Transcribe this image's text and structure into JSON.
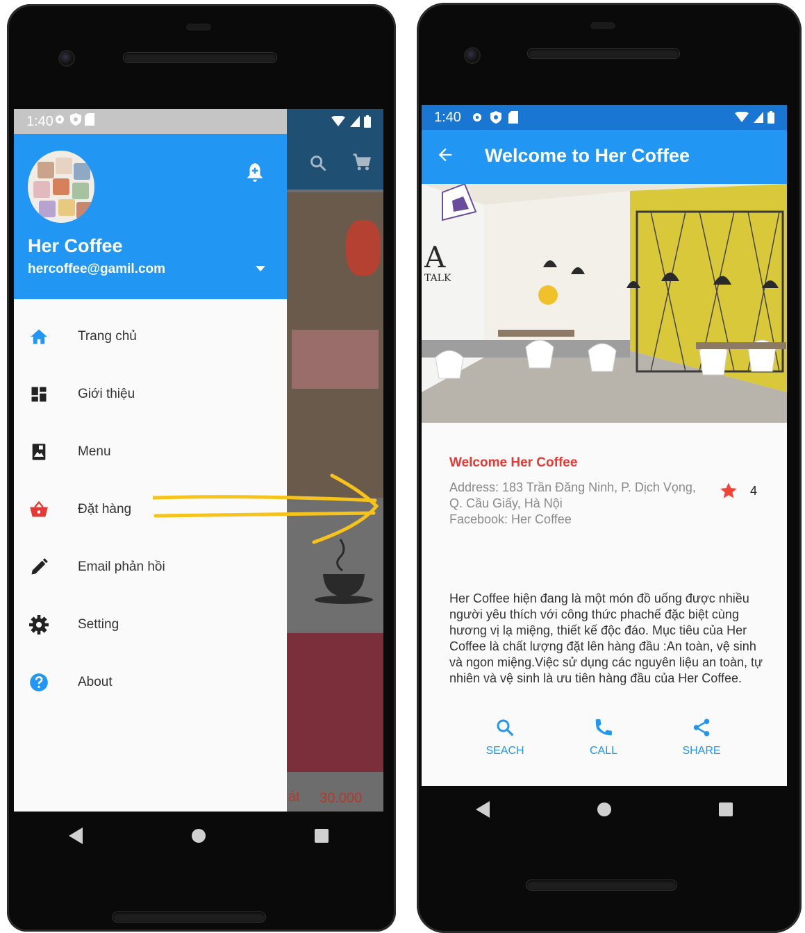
{
  "left_phone": {
    "status": {
      "time": "1:40"
    },
    "drawer": {
      "name": "Her Coffee",
      "email": "hercoffee@gamil.com",
      "items": [
        {
          "label": "Trang chủ",
          "icon": "home-icon"
        },
        {
          "label": "Giới thiệu",
          "icon": "dashboard-icon"
        },
        {
          "label": "Menu",
          "icon": "menu-book-icon"
        },
        {
          "label": "Đặt hàng",
          "icon": "basket-icon"
        },
        {
          "label": "Email phản hồi",
          "icon": "pencil-icon"
        },
        {
          "label": "Setting",
          "icon": "gear-icon"
        },
        {
          "label": "About",
          "icon": "help-icon"
        }
      ]
    },
    "background": {
      "price": "30.000",
      "price_prefix": "át"
    }
  },
  "right_phone": {
    "status": {
      "time": "1:40"
    },
    "appbar": {
      "title": "Welcome to Her Coffee"
    },
    "info": {
      "heading": "Welcome Her Coffee",
      "address": "Address: 183 Trần Đăng Ninh, P. Dịch Vọng, Q. Cầu Giấy, Hà Nội",
      "facebook": "Facebook: Her Coffee",
      "rating": "4"
    },
    "description": " Her Coffee hiện đang là một món đồ uống được nhiều người yêu thích với công thức phachế đặc biệt cùng hương vị lạ miệng, thiết kế độc đáo. Mục tiêu của Her Coffee là chất lượng đặt lên hàng đầu :An toàn, vệ sinh và ngon miệng.Việc sử dụng các nguyên liệu an toàn, tự nhiên và vệ sinh là ưu tiên hàng đầu của Her Coffee.",
    "actions": [
      {
        "label": "SEACH",
        "icon": "search-icon"
      },
      {
        "label": "CALL",
        "icon": "phone-icon"
      },
      {
        "label": "SHARE",
        "icon": "share-icon"
      }
    ]
  },
  "colors": {
    "primary": "#2196f3",
    "status_dark": "#1976d2",
    "accent_red": "#e53935",
    "annotation": "#f6c21c"
  }
}
